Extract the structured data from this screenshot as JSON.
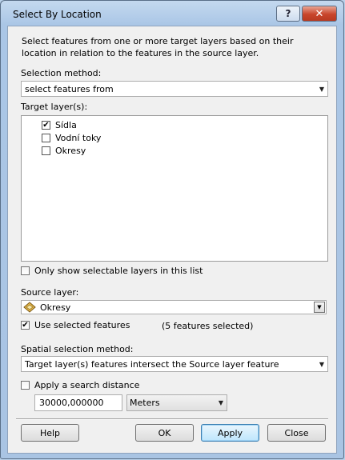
{
  "window": {
    "title": "Select By Location",
    "help_glyph": "?",
    "close_glyph": "✕"
  },
  "description": "Select features from one or more target layers based on their location in relation to the features in the source layer.",
  "selection_method": {
    "label": "Selection method:",
    "value": "select features from"
  },
  "target_layers": {
    "label": "Target layer(s):",
    "items": [
      {
        "label": "Sídla",
        "checked": true
      },
      {
        "label": "Vodní toky",
        "checked": false
      },
      {
        "label": "Okresy",
        "checked": false
      }
    ]
  },
  "only_selectable": {
    "label": "Only show selectable layers in this list",
    "checked": false
  },
  "source_layer": {
    "label": "Source layer:",
    "value": "Okresy",
    "icon": "polygon-layer-icon"
  },
  "use_selected": {
    "label": "Use selected features",
    "checked": true,
    "count_text": "(5 features selected)"
  },
  "spatial_method": {
    "label": "Spatial selection method:",
    "value": "Target layer(s) features intersect the Source layer feature"
  },
  "search_distance": {
    "label": "Apply a search distance",
    "checked": false,
    "value": "30000,000000",
    "unit": "Meters"
  },
  "buttons": {
    "help": "Help",
    "ok": "OK",
    "apply": "Apply",
    "close": "Close"
  },
  "colors": {
    "accent": "#3c7fb1",
    "frame": "#aac6e6"
  }
}
